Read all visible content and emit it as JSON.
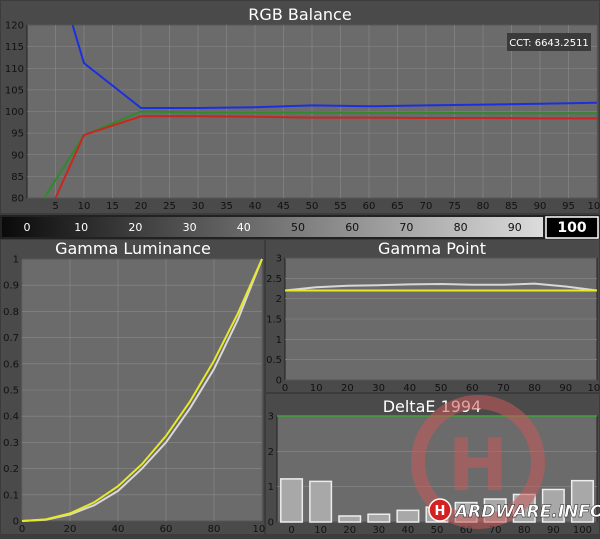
{
  "colors": {
    "red": "#c8261e",
    "green": "#2f8a27",
    "blue": "#1c2fe0",
    "white": "#d8d8d8",
    "yellow": "#e8e82a",
    "green_ref": "#3da33d"
  },
  "chart_data": [
    {
      "id": "rgb_balance",
      "type": "line",
      "title": "RGB Balance",
      "xlim": [
        0,
        100
      ],
      "ylim": [
        80,
        120
      ],
      "xticks": [
        5,
        10,
        15,
        20,
        25,
        30,
        35,
        40,
        45,
        50,
        55,
        60,
        65,
        70,
        75,
        80,
        85,
        90,
        95,
        100
      ],
      "yticks": [
        80,
        85,
        90,
        95,
        100,
        105,
        110,
        115,
        120
      ],
      "annotation": "CCT: 6643.2511",
      "series": [
        {
          "color": "blue",
          "x": [
            8,
            10,
            20,
            30,
            40,
            50,
            60,
            70,
            80,
            90,
            100
          ],
          "y": [
            120,
            111.2,
            100.8,
            100.8,
            101.0,
            101.4,
            101.2,
            101.4,
            101.6,
            101.8,
            102.0
          ]
        },
        {
          "color": "green",
          "x": [
            3,
            10,
            20,
            30,
            40,
            50,
            60,
            70,
            80,
            90,
            100
          ],
          "y": [
            80,
            94.5,
            100.0,
            99.8,
            99.8,
            99.8,
            99.7,
            99.7,
            99.6,
            99.6,
            99.6
          ]
        },
        {
          "color": "red",
          "x": [
            5,
            10,
            20,
            30,
            40,
            50,
            60,
            70,
            80,
            90,
            100
          ],
          "y": [
            80,
            94.6,
            98.9,
            98.9,
            98.8,
            98.6,
            98.6,
            98.5,
            98.5,
            98.4,
            98.4
          ]
        }
      ]
    },
    {
      "id": "gamma_luminance",
      "type": "line",
      "title": "Gamma Luminance",
      "xlim": [
        0,
        100
      ],
      "ylim": [
        0,
        1
      ],
      "xticks": [
        0,
        20,
        40,
        60,
        80,
        100
      ],
      "yticks": [
        0,
        0.1,
        0.2,
        0.3,
        0.4,
        0.5,
        0.6,
        0.7,
        0.8,
        0.9,
        1
      ],
      "series": [
        {
          "color": "white",
          "x": [
            0,
            10,
            20,
            30,
            40,
            50,
            60,
            70,
            80,
            90,
            100
          ],
          "y": [
            0,
            0.005,
            0.025,
            0.06,
            0.115,
            0.2,
            0.3,
            0.43,
            0.58,
            0.77,
            1.0
          ]
        },
        {
          "color": "yellow",
          "x": [
            0,
            10,
            20,
            30,
            40,
            50,
            60,
            70,
            80,
            90,
            100
          ],
          "y": [
            0,
            0.006,
            0.029,
            0.071,
            0.133,
            0.217,
            0.325,
            0.456,
            0.612,
            0.793,
            1.0
          ]
        }
      ]
    },
    {
      "id": "gamma_point",
      "type": "line",
      "title": "Gamma Point",
      "xlim": [
        0,
        100
      ],
      "ylim": [
        0,
        3
      ],
      "xticks": [
        0,
        10,
        20,
        30,
        40,
        50,
        60,
        70,
        80,
        90,
        100
      ],
      "yticks": [
        0,
        0.5,
        1,
        1.5,
        2,
        2.5,
        3
      ],
      "series": [
        {
          "color": "white",
          "x": [
            0,
            10,
            20,
            30,
            40,
            50,
            60,
            70,
            80,
            90,
            100
          ],
          "y": [
            2.2,
            2.28,
            2.32,
            2.33,
            2.35,
            2.36,
            2.34,
            2.34,
            2.37,
            2.3,
            2.2
          ]
        },
        {
          "color": "yellow",
          "x": [
            0,
            100
          ],
          "y": [
            2.2,
            2.2
          ]
        }
      ]
    },
    {
      "id": "deltae_1994",
      "type": "bar",
      "title": "DeltaE 1994",
      "xlim": [
        -5,
        105
      ],
      "ylim": [
        0,
        3
      ],
      "xticks": [
        0,
        10,
        20,
        30,
        40,
        50,
        60,
        70,
        80,
        90,
        100
      ],
      "yticks": [
        0,
        1,
        2,
        3
      ],
      "threshold": 3,
      "categories": [
        0,
        10,
        20,
        30,
        40,
        50,
        60,
        70,
        80,
        90,
        100
      ],
      "values": [
        1.22,
        1.15,
        0.17,
        0.22,
        0.33,
        0.42,
        0.55,
        0.65,
        0.78,
        0.92,
        1.17
      ]
    }
  ],
  "stimulus": {
    "labels": [
      "0",
      "10",
      "20",
      "30",
      "40",
      "50",
      "60",
      "70",
      "80",
      "90"
    ],
    "current": "100"
  },
  "watermark": {
    "brand": "HARDWARE.INFO"
  }
}
